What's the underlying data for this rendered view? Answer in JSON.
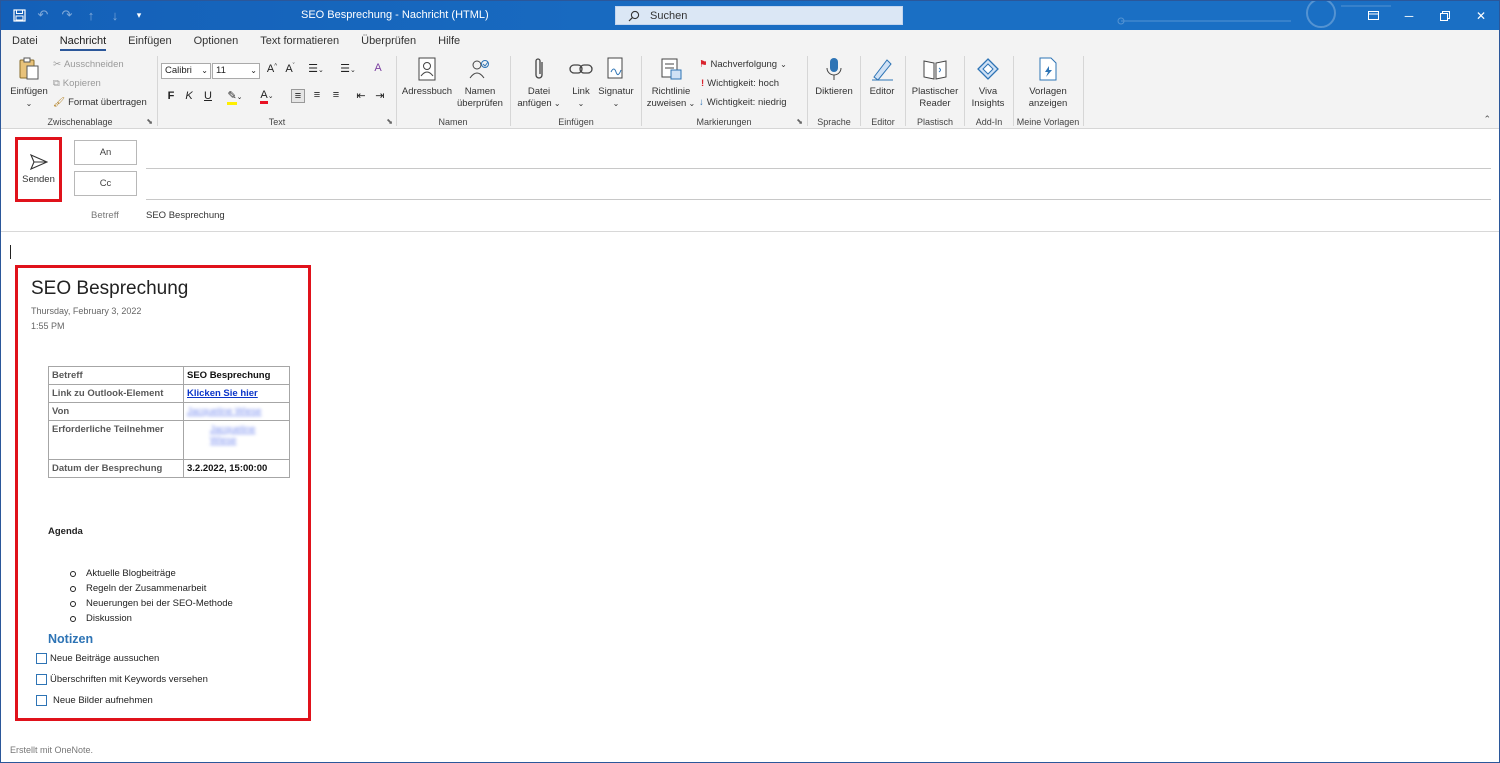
{
  "window": {
    "title": "SEO Besprechung  -  Nachricht (HTML)",
    "search_placeholder": "Suchen"
  },
  "tabs": [
    "Datei",
    "Nachricht",
    "Einfügen",
    "Optionen",
    "Text formatieren",
    "Überprüfen",
    "Hilfe"
  ],
  "ribbon": {
    "clipboard": {
      "paste": "Einfügen",
      "cut": "Ausschneiden",
      "copy": "Kopieren",
      "format_painter": "Format übertragen",
      "label": "Zwischenablage"
    },
    "text": {
      "font": "Calibri",
      "size": "11",
      "bold": "F",
      "italic": "K",
      "underline": "U",
      "label": "Text"
    },
    "names": {
      "address_book": "Adressbuch",
      "check_names_1": "Namen",
      "check_names_2": "überprüfen",
      "label": "Namen"
    },
    "insert": {
      "attach_1": "Datei",
      "attach_2": "anfügen",
      "link": "Link",
      "signature": "Signatur",
      "label": "Einfügen"
    },
    "tags": {
      "policy_1": "Richtlinie",
      "policy_2": "zuweisen",
      "followup": "Nachverfolgung",
      "high": "Wichtigkeit: hoch",
      "low": "Wichtigkeit: niedrig",
      "label": "Markierungen"
    },
    "voice": {
      "dictate": "Diktieren",
      "label": "Sprache"
    },
    "editor": {
      "editor": "Editor",
      "label": "Editor"
    },
    "immersive": {
      "reader_1": "Plastischer",
      "reader_2": "Reader",
      "label": "Plastisch"
    },
    "addin": {
      "viva_1": "Viva",
      "viva_2": "Insights",
      "label": "Add-In"
    },
    "templates": {
      "t_1": "Vorlagen",
      "t_2": "anzeigen",
      "label": "Meine Vorlagen"
    }
  },
  "header": {
    "send": "Senden",
    "to": "An",
    "cc": "Cc",
    "subject_label": "Betreff",
    "subject_value": "SEO Besprechung"
  },
  "note": {
    "title": "SEO Besprechung",
    "date": "Thursday, February 3, 2022",
    "time": "1:55 PM",
    "table": {
      "r1k": "Betreff",
      "r1v": "SEO Besprechung",
      "r2k": "Link zu Outlook-Element",
      "r2v": "Klicken Sie hier",
      "r3k": "Von",
      "r3v": "Jacqueline Wiese",
      "r4k": "Erforderliche Teilnehmer",
      "r4v": "Jacqueline Wiese",
      "r5k": "Datum der Besprechung",
      "r5v": "3.2.2022, 15:00:00"
    },
    "agenda_heading": "Agenda",
    "agenda": [
      "Aktuelle Blogbeiträge",
      "Regeln der Zusammenarbeit",
      "Neuerungen bei der SEO-Methode",
      "Diskussion"
    ],
    "notes_heading": "Notizen",
    "todos": [
      "Neue Beiträge aussuchen",
      "Überschriften mit Keywords versehen",
      "Neue Bilder aufnehmen"
    ]
  },
  "footer": "Erstellt mit OneNote."
}
